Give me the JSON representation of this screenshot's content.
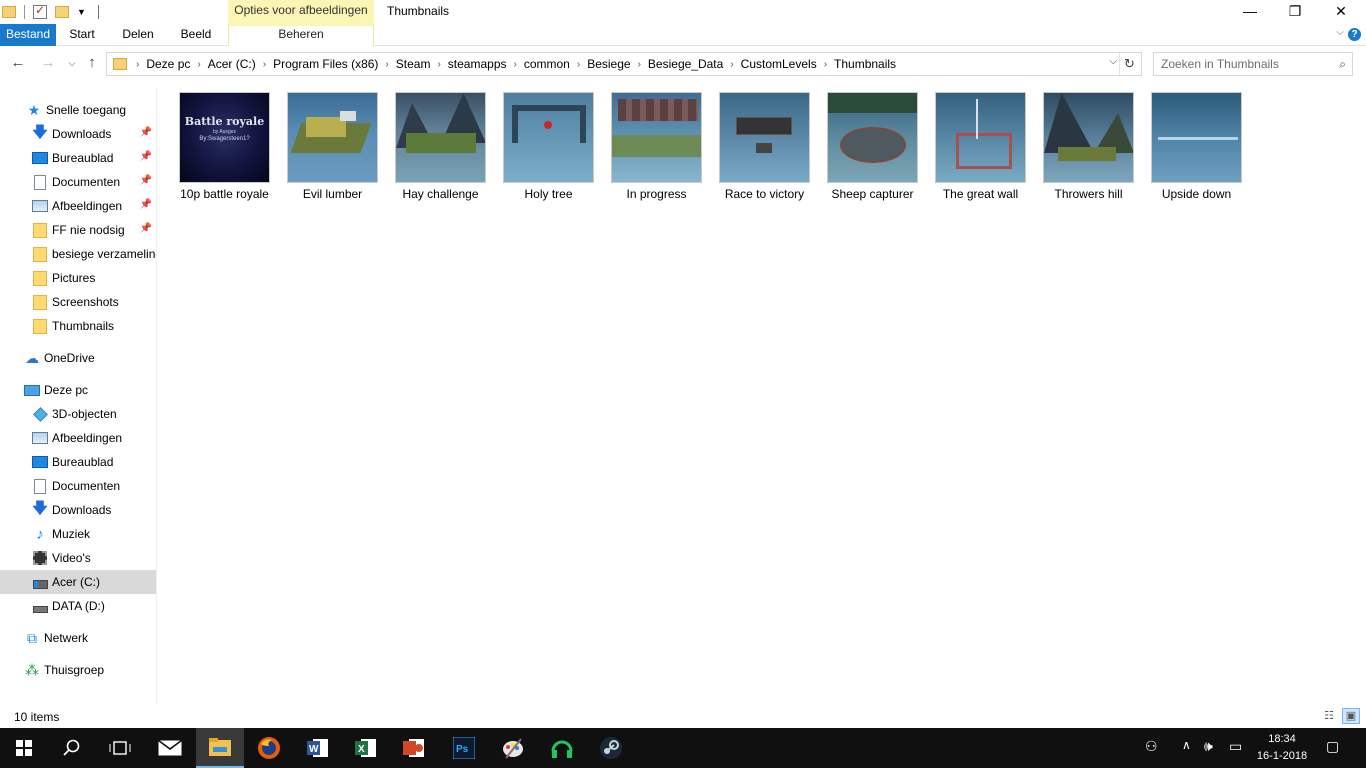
{
  "window": {
    "title": "Thumbnails",
    "context_tab_group": "Opties voor afbeeldingen"
  },
  "ribbon": {
    "tabs": [
      "Bestand",
      "Start",
      "Delen",
      "Beeld",
      "Beheren"
    ]
  },
  "address": {
    "crumbs": [
      "Deze pc",
      "Acer (C:)",
      "Program Files (x86)",
      "Steam",
      "steamapps",
      "common",
      "Besiege",
      "Besiege_Data",
      "CustomLevels",
      "Thumbnails"
    ]
  },
  "search": {
    "placeholder": "Zoeken in Thumbnails"
  },
  "navigation": {
    "quick_access": {
      "label": "Snelle toegang",
      "items": [
        {
          "label": "Downloads",
          "icon": "download-icon",
          "pinned": true
        },
        {
          "label": "Bureaublad",
          "icon": "desktop-icon",
          "pinned": true
        },
        {
          "label": "Documenten",
          "icon": "document-icon",
          "pinned": true
        },
        {
          "label": "Afbeeldingen",
          "icon": "pictures-icon",
          "pinned": true
        },
        {
          "label": "FF nie nodsig",
          "icon": "folder-icon",
          "pinned": true
        },
        {
          "label": "besiege verzameling",
          "icon": "folder-icon",
          "pinned": false
        },
        {
          "label": "Pictures",
          "icon": "folder-icon",
          "pinned": false
        },
        {
          "label": "Screenshots",
          "icon": "folder-icon",
          "pinned": false
        },
        {
          "label": "Thumbnails",
          "icon": "folder-icon",
          "pinned": false
        }
      ]
    },
    "onedrive": "OneDrive",
    "this_pc": {
      "label": "Deze pc",
      "items": [
        {
          "label": "3D-objecten",
          "icon": "cube-icon"
        },
        {
          "label": "Afbeeldingen",
          "icon": "pictures-icon"
        },
        {
          "label": "Bureaublad",
          "icon": "desktop-icon"
        },
        {
          "label": "Documenten",
          "icon": "document-icon"
        },
        {
          "label": "Downloads",
          "icon": "download-icon"
        },
        {
          "label": "Muziek",
          "icon": "music-icon"
        },
        {
          "label": "Video's",
          "icon": "video-icon"
        },
        {
          "label": "Acer (C:)",
          "icon": "drive-c-icon",
          "selected": true
        },
        {
          "label": "DATA (D:)",
          "icon": "drive-icon"
        }
      ]
    },
    "network": "Netwerk",
    "homegroup": "Thuisgroep"
  },
  "files": [
    {
      "name": "10p battle royale",
      "thumb_title": "Battle royale",
      "thumb_sub": "by Ausgez",
      "thumb_line": "By:Swagersteen1?"
    },
    {
      "name": "Evil lumber"
    },
    {
      "name": "Hay challenge"
    },
    {
      "name": "Holy tree"
    },
    {
      "name": "In progress"
    },
    {
      "name": "Race to victory"
    },
    {
      "name": "Sheep capturer"
    },
    {
      "name": "The great wall"
    },
    {
      "name": "Throwers hill"
    },
    {
      "name": "Upside down"
    }
  ],
  "status": {
    "item_count": "10 items"
  },
  "clock": {
    "time": "18:34",
    "date": "16-1-2018"
  },
  "colors": {
    "accent": "#1979ca",
    "context_tab": "#fbf6b5",
    "selected_nav": "#d9d9d9",
    "taskbar": "#101010"
  }
}
